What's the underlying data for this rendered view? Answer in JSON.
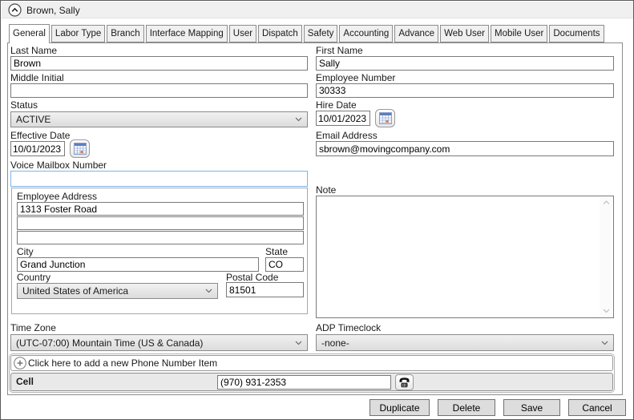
{
  "window": {
    "title": "Brown, Sally"
  },
  "tabs": [
    {
      "label": "General",
      "active": true
    },
    {
      "label": "Labor Type",
      "active": false
    },
    {
      "label": "Branch",
      "active": false
    },
    {
      "label": "Interface Mapping",
      "active": false
    },
    {
      "label": "User",
      "active": false
    },
    {
      "label": "Dispatch",
      "active": false
    },
    {
      "label": "Safety",
      "active": false
    },
    {
      "label": "Accounting",
      "active": false
    },
    {
      "label": "Advance",
      "active": false
    },
    {
      "label": "Web User",
      "active": false
    },
    {
      "label": "Mobile User",
      "active": false
    },
    {
      "label": "Documents",
      "active": false
    }
  ],
  "fields": {
    "last_name": {
      "label": "Last Name",
      "value": "Brown"
    },
    "first_name": {
      "label": "First Name",
      "value": "Sally"
    },
    "middle_initial": {
      "label": "Middle Initial",
      "value": ""
    },
    "employee_number": {
      "label": "Employee Number",
      "value": "30333"
    },
    "status": {
      "label": "Status",
      "value": "ACTIVE"
    },
    "hire_date": {
      "label": "Hire Date",
      "value": "10/01/2023"
    },
    "effective_date": {
      "label": "Effective Date",
      "value": "10/01/2023"
    },
    "email": {
      "label": "Email Address",
      "value": "sbrown@movingcompany.com"
    },
    "voice_mailbox": {
      "label": "Voice Mailbox Number",
      "value": ""
    },
    "address": {
      "group_label": "Employee Address",
      "line1": "1313 Foster Road",
      "line2": "",
      "line3": "",
      "city": {
        "label": "City",
        "value": "Grand Junction"
      },
      "state": {
        "label": "State",
        "value": "CO"
      },
      "country": {
        "label": "Country",
        "value": "United States of America"
      },
      "postal": {
        "label": "Postal Code",
        "value": "81501"
      }
    },
    "note": {
      "label": "Note",
      "value": ""
    },
    "time_zone": {
      "label": "Time Zone",
      "value": "(UTC-07:00) Mountain Time (US & Canada)"
    },
    "adp_timeclock": {
      "label": "ADP Timeclock",
      "value": "-none-"
    }
  },
  "phone": {
    "add_label": "Click here to add a new Phone Number Item",
    "items": [
      {
        "type": "Cell",
        "number": "(970) 931-2353"
      }
    ]
  },
  "buttons": {
    "duplicate": "Duplicate",
    "delete": "Delete",
    "save": "Save",
    "cancel": "Cancel"
  }
}
